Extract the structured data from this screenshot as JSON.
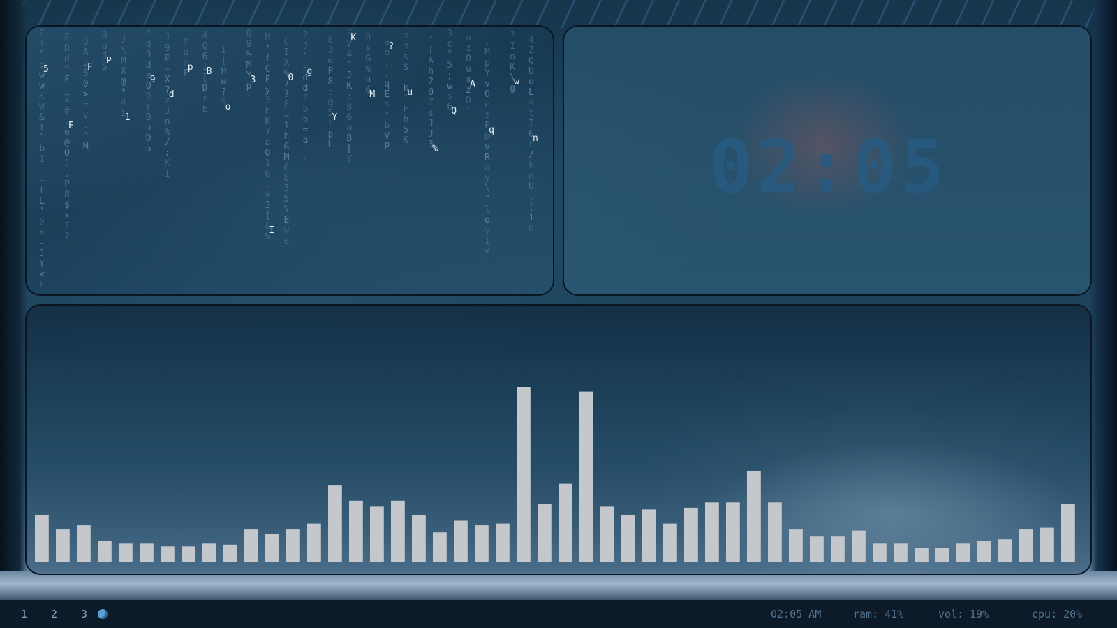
{
  "colors": {
    "bar": "#c4c7cc",
    "matrix_dim": "#6f98b8",
    "matrix_bright": "#e6eef5",
    "clock": "#2d5f88",
    "taskbar_bg": "#0c1a2a",
    "accent": "#5aa0d8"
  },
  "workspaces": [
    "1",
    "2",
    "3"
  ],
  "clock": {
    "time": "02:05"
  },
  "status": {
    "time": "02:05 AM",
    "ram": "ram: 41%",
    "vol": "vol: 19%",
    "cpu": "cpu: 20%"
  },
  "matrix": {
    "columns": [
      "E4\":wwKW&f`b1-=tL'0>-JY<F",
      "EDd^F_+#.e@QJ.P8$x7?",
      "UAJ50>=v.^M",
      "RuJ5",
      "J\\MX@*4i",
      "*d9deQOrBuDo",
      "J9F=X?zJo%/:KI",
      "MamF",
      "4Q6I[DrE",
      "-i[Hw?9",
      "Q9%MYp:",
      "M*fCFy3hK7aO1G.x3(&%",
      "CIX%7?8=1hGM6835\\Ewe",
      "2J\"=ddFbb=a-\"",
      "EJdP8:@5tpL",
      "FV4^JK:B6oB[Y",
      "QsG%u6",
      "ao:,qE$*bVP",
      "mms$.k\"Fb5K",
      "\"[Ah20ZsJJ3",
      "3c\"5;ws6",
      "ozOuxzD'",
      ".MpYvOezE@vRay\\\"loyI<",
      "?IoK\\g",
      "4ZQUoL<tI6t/knU.(1n"
    ],
    "bright_chars": [
      "5",
      "E",
      "F",
      "P",
      "1",
      "9",
      "d",
      "p",
      "B",
      "o",
      "3",
      "I",
      "0",
      "g",
      "Y",
      "K",
      "M",
      "?",
      "u",
      "%",
      "Q",
      "A",
      "q",
      "w",
      "n",
      "<"
    ]
  },
  "visualizer": {
    "levels": [
      0.27,
      0.19,
      0.21,
      0.12,
      0.11,
      0.11,
      0.09,
      0.09,
      0.11,
      0.1,
      0.19,
      0.16,
      0.19,
      0.22,
      0.44,
      0.35,
      0.32,
      0.35,
      0.27,
      0.17,
      0.24,
      0.21,
      0.22,
      1.0,
      0.33,
      0.45,
      0.97,
      0.32,
      0.27,
      0.3,
      0.22,
      0.31,
      0.34,
      0.34,
      0.52,
      0.34,
      0.19,
      0.15,
      0.15,
      0.18,
      0.11,
      0.11,
      0.08,
      0.08,
      0.11,
      0.12,
      0.13,
      0.19,
      0.2,
      0.33
    ]
  }
}
